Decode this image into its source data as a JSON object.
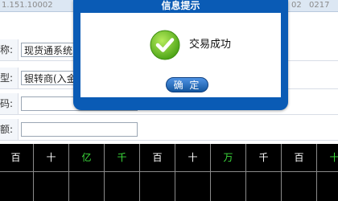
{
  "top_strip": [
    "1.151.10002",
    "02",
    "0217"
  ],
  "form": {
    "rows": [
      {
        "label": "称:",
        "value": "现货通系统"
      },
      {
        "label": "型:",
        "value": "银转商(入金"
      },
      {
        "label": "码:",
        "value": ""
      },
      {
        "label": "额:",
        "value": ""
      }
    ]
  },
  "ruler": {
    "units": [
      "百",
      "十",
      "亿",
      "千",
      "百",
      "十",
      "万",
      "千",
      "百",
      "十"
    ],
    "unit_colors": [
      "#ffffff",
      "#ffffff",
      "#3cdc3c",
      "#3cdc3c",
      "#ffffff",
      "#ffffff",
      "#3cdc3c",
      "#ffffff",
      "#ffffff",
      "#3cdc3c"
    ]
  },
  "modal": {
    "title": "信息提示",
    "message": "交易成功",
    "icon": "check-circle-icon",
    "ok_label": "确 定",
    "frame_color": "#0a5bb5",
    "icon_color": "#6cc22a"
  }
}
